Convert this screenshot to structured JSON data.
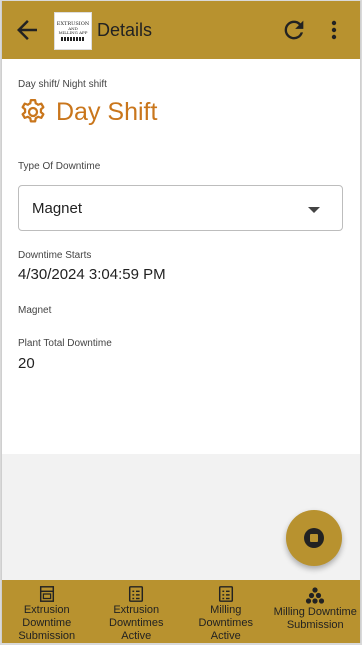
{
  "appbar": {
    "title": "Details",
    "logo_line1": "EXTRUSION",
    "logo_line2": "AND",
    "logo_line3": "MILLING APP"
  },
  "shift": {
    "label": "Day shift/ Night shift",
    "value": "Day Shift",
    "icon": "gear-icon",
    "color": "#c9761c"
  },
  "downtime_type": {
    "label": "Type Of Downtime",
    "selected": "Magnet"
  },
  "downtime_starts": {
    "label": "Downtime Starts",
    "value": "4/30/2024 3:04:59 PM"
  },
  "magnet_label": "Magnet",
  "plant_total": {
    "label": "Plant Total Downtime",
    "value": "20"
  },
  "fab": {
    "icon": "stop-icon"
  },
  "bottom_nav": [
    {
      "label": "Extrusion Downtime Submission",
      "icon": "machine-icon"
    },
    {
      "label": "Extrusion Downtimes Active",
      "icon": "list-icon"
    },
    {
      "label": "Milling Downtimes Active",
      "icon": "list-icon"
    },
    {
      "label": "Milling Downtime Submission",
      "icon": "pile-icon"
    }
  ],
  "colors": {
    "brand": "#b8922f",
    "accent": "#c9761c",
    "background": "#f2f2f2"
  }
}
